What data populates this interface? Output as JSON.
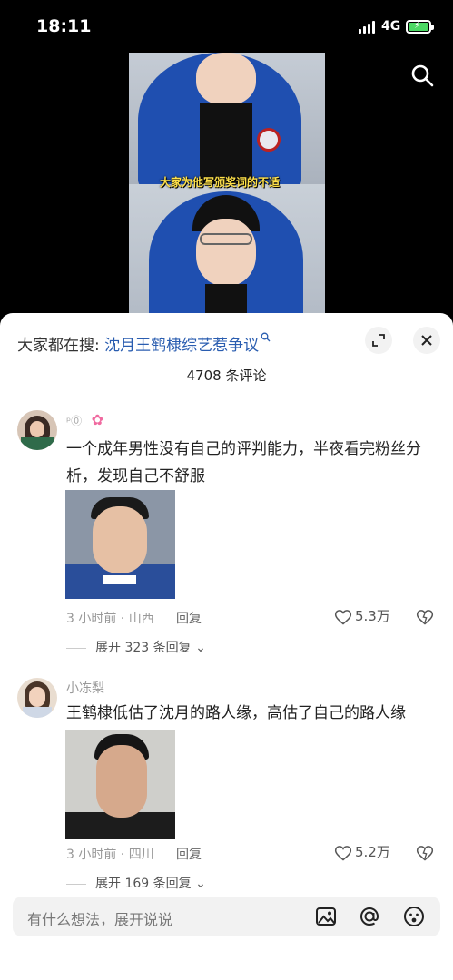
{
  "status_bar": {
    "time": "18:11",
    "network": "4G"
  },
  "video": {
    "caption": "大家为他写颁奖词的不适"
  },
  "sheet": {
    "search_prefix": "大家都在搜: ",
    "search_query": "沈月王鹤棣综艺惹争议",
    "comment_count": "4708 条评论"
  },
  "comments": [
    {
      "username": "",
      "text": "一个成年男性没有自己的评判能力，半夜看完粉丝分析，发现自己不舒服",
      "time_location": "3 小时前 · 山西",
      "reply_label": "回复",
      "likes": "5.3万",
      "expand_label": "展开 323 条回复"
    },
    {
      "username": "小冻梨",
      "text": "王鹤棣低估了沈月的路人缘，高估了自己的路人缘",
      "time_location": "3 小时前 · 四川",
      "reply_label": "回复",
      "likes": "5.2万",
      "expand_label": "展开 169 条回复"
    }
  ],
  "input": {
    "placeholder": "有什么想法，展开说说"
  },
  "colors": {
    "accent_link": "#2a5db0",
    "hoodie_blue": "#1f4fb0",
    "battery_green": "#4cd964"
  },
  "icons": [
    "signal-icon",
    "battery-icon",
    "search-icon",
    "expand-icon",
    "close-icon",
    "heart-icon",
    "dislike-heart-icon",
    "image-icon",
    "at-icon",
    "emoji-icon"
  ]
}
